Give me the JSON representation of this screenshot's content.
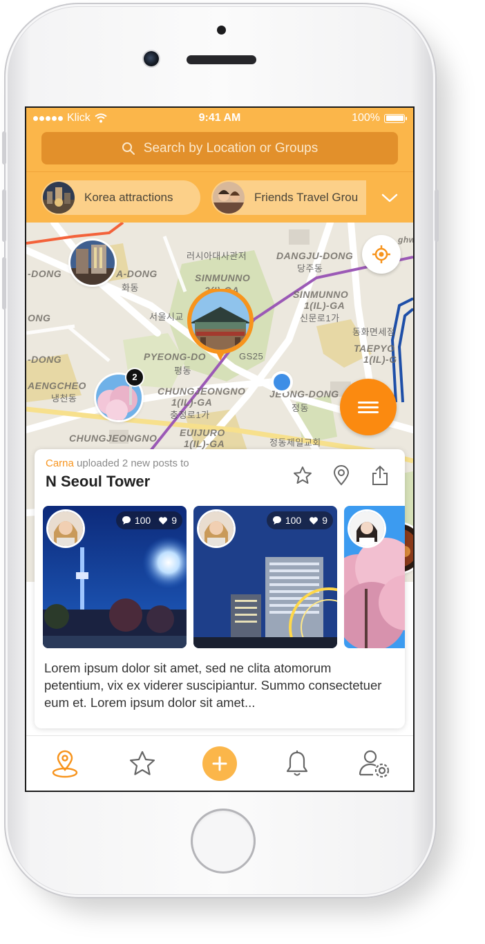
{
  "status_bar": {
    "carrier": "Klick",
    "time": "9:41 AM",
    "battery": "100%"
  },
  "search": {
    "placeholder": "Search by Location or Groups"
  },
  "groups": [
    {
      "label": "Korea attractions"
    },
    {
      "label": "Friends Travel Grou"
    }
  ],
  "map": {
    "labels": [
      "러시아대사관저",
      "DANGJU-DONG",
      "당주동",
      "SINMUNNO",
      "2(I)-GA",
      "-DONG",
      "A-DONG",
      "화동",
      "ONG",
      "서울시교",
      "SINMUNNO",
      "1(IL)-GA",
      "신문로1가",
      "동화면세점",
      "TAEPYO",
      "1(IL)-G",
      "-DONG",
      "PYEONG-DO",
      "평동",
      "GS25",
      "AENGCHEO",
      "냉천동",
      "CHUNGJEONGNO",
      "1(IL)-GA",
      "충정로1가",
      "JEONG-DONG",
      "정동",
      "CHUNGJEONGNO",
      "EUIJURO",
      "1(IL)-GA",
      "정동제일교회",
      "ghw"
    ],
    "cluster_badge": "2",
    "accent_color": "#f7941d",
    "user_location_color": "#3e8ee6"
  },
  "post": {
    "user": "Carna",
    "action": "uploaded 2 new posts to",
    "place": "N Seoul Tower",
    "thumbnails": [
      {
        "comments": "100",
        "likes": "9"
      },
      {
        "comments": "100",
        "likes": "9"
      },
      {}
    ],
    "text": "Lorem ipsum dolor sit amet, sed ne clita atomorum petentium, vix ex viderer suscipiantur. Summo consectetuer eum et. Lorem ipsum dolor sit amet..."
  },
  "tabbar": {
    "active": "map",
    "items": [
      "map-pin-icon",
      "star-icon",
      "add-icon",
      "bell-icon",
      "user-settings-icon"
    ]
  },
  "colors": {
    "brand": "#fbb64a",
    "search_bg": "#e2902b",
    "fab": "#fb8a10"
  }
}
